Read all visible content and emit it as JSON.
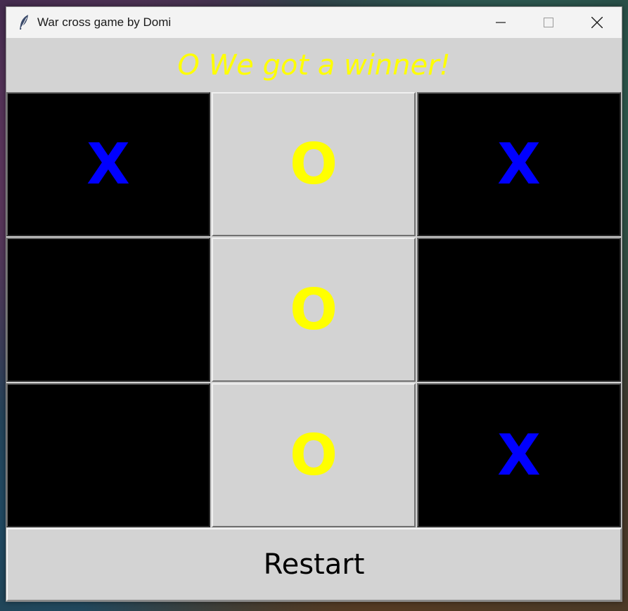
{
  "window": {
    "title": "War cross game by Domi",
    "icon": "feather-icon",
    "controls": [
      "minimize-icon",
      "maximize-icon",
      "close-icon"
    ]
  },
  "status": {
    "text": "O We got a winner!",
    "color": "#ffff00"
  },
  "board": {
    "cells": [
      {
        "mark": "X",
        "bg": "black"
      },
      {
        "mark": "O",
        "bg": "gray"
      },
      {
        "mark": "X",
        "bg": "black"
      },
      {
        "mark": "",
        "bg": "black"
      },
      {
        "mark": "O",
        "bg": "gray"
      },
      {
        "mark": "",
        "bg": "black"
      },
      {
        "mark": "",
        "bg": "black"
      },
      {
        "mark": "O",
        "bg": "gray"
      },
      {
        "mark": "X",
        "bg": "black"
      }
    ],
    "colors": {
      "x": "#0000ff",
      "o": "#ffff00",
      "cell_dark": "#000000",
      "cell_light": "#d3d3d3"
    }
  },
  "restart": {
    "label": "Restart"
  }
}
